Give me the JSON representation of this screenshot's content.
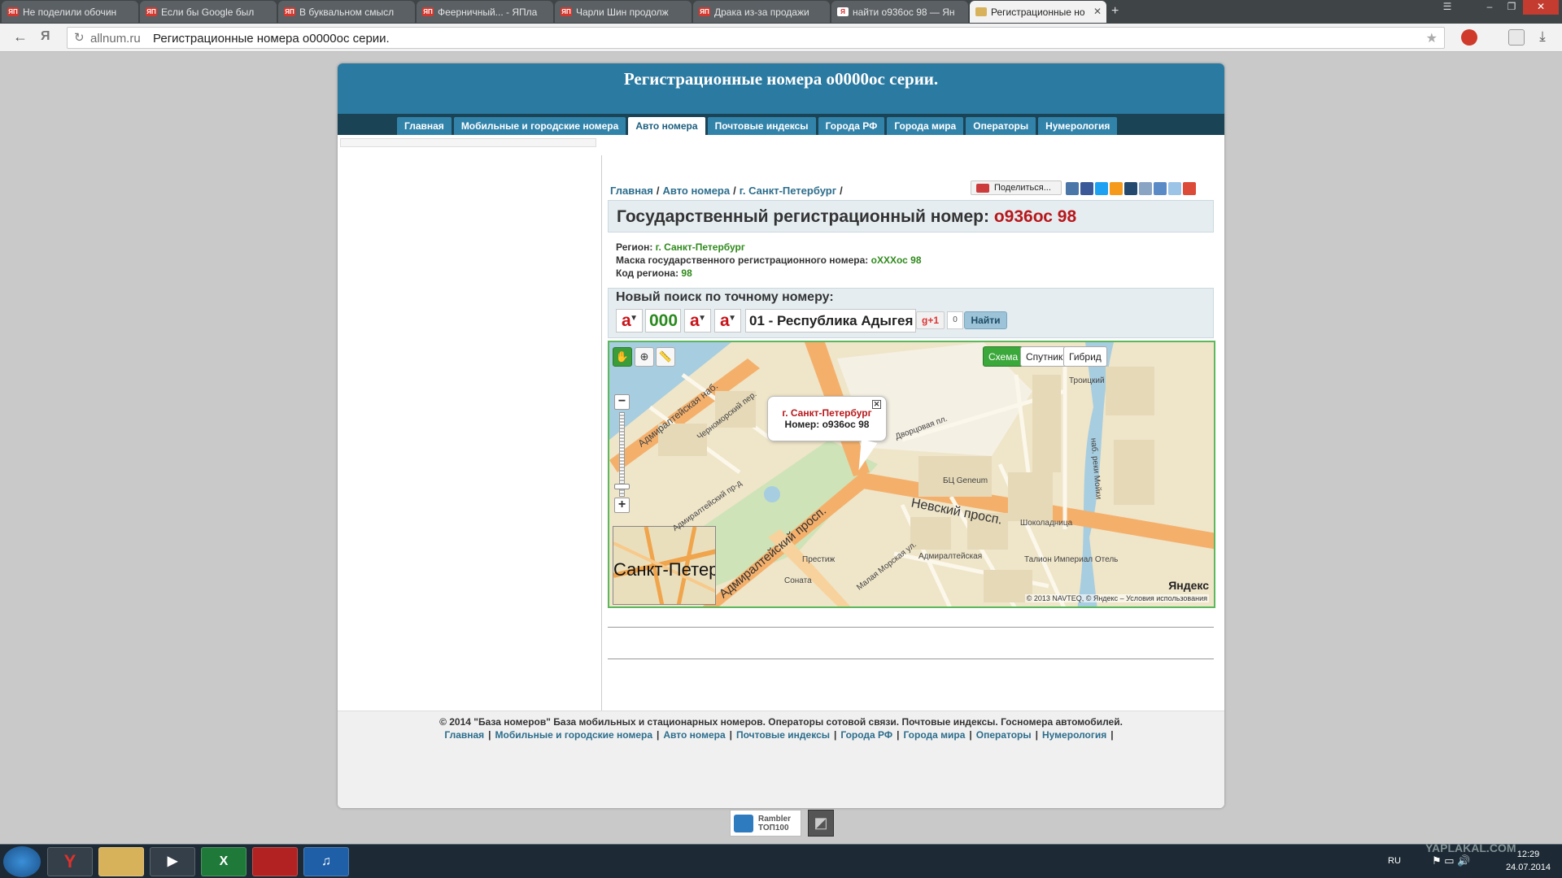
{
  "browser": {
    "tabs": [
      {
        "label": "Не поделили обочин"
      },
      {
        "label": "Если бы Google был"
      },
      {
        "label": "В буквальном смысл"
      },
      {
        "label": "Феерничный... - ЯПла"
      },
      {
        "label": "Чарли Шин продолж"
      },
      {
        "label": "Драка из-за продажи"
      },
      {
        "label": "найти о936ос 98 — Ян"
      },
      {
        "label": "Регистрационные но"
      }
    ],
    "active_tab": 7,
    "url_host": "allnum.ru",
    "url_title": "Регистрационные номера о0000ос серии."
  },
  "site": {
    "title": "Регистрационные номера о0000ос серии.",
    "nav": [
      {
        "label": "Главная"
      },
      {
        "label": "Мобильные и городские номера"
      },
      {
        "label": "Авто номера"
      },
      {
        "label": "Почтовые индексы"
      },
      {
        "label": "Города РФ"
      },
      {
        "label": "Города мира"
      },
      {
        "label": "Операторы"
      },
      {
        "label": "Нумерология"
      }
    ],
    "active_nav": 2,
    "breadcrumb": [
      "Главная",
      "Авто номера",
      "г. Санкт-Петербург"
    ],
    "share_label": "Поделиться...",
    "heading_prefix": "Государственный регистрационный номер:",
    "heading_plate": "о936ос 98",
    "details": {
      "region_label": "Регион:",
      "region_value": "г. Санкт-Петербург",
      "mask_label": "Маска государственного регистрационного номера:",
      "mask_value": "оXXXос 98",
      "code_label": "Код региона:",
      "code_value": "98"
    },
    "search": {
      "heading": "Новый поиск по точному номеру:",
      "letter1": "а",
      "digits": "000",
      "letter2": "а",
      "letter3": "а",
      "region": "01 - Республика Адыгея",
      "gplus": "g+1",
      "gcount": "0",
      "button": "Найти"
    },
    "map": {
      "types": [
        "Схема",
        "Спутник",
        "Гибрид"
      ],
      "active_type": 0,
      "popup_city": "г. Санкт-Петербург",
      "popup_number": "Номер: о936ос 98",
      "minimap_label": "Санкт-Петербу",
      "labels": {
        "nevsky": "Невский просп.",
        "admiralteysky": "Адмиралтейский просп.",
        "admiralteyskaya_nab": "Адмиралтейская наб.",
        "admiralteysky_pr": "Адмиралтейский пр-д",
        "chernomorsky": "Черноморский пер.",
        "dvortsovaya": "Дворцовая пл.",
        "moyka": "наб. реки Мойки",
        "geneum": "БЦ Geneum",
        "metro": "Адмиралтейская",
        "taleon": "Талион Империал Отель",
        "shokoladnitsa": "Шоколадница",
        "prestizh": "Престиж",
        "sonata": "Соната",
        "malaya_morskaya": "Малая Морская ул.",
        "troitsky": "Троицкий"
      },
      "copyright": "© 2013 NAVTEQ, © Яндекс – Условия использования",
      "logo": "Яндекс"
    },
    "footer": {
      "text": "© 2014 \"База номеров\" База мобильных и стационарных номеров. Операторы сотовой связи. Почтовые индексы. Госномера автомобилей.",
      "links": [
        "Главная",
        "Мобильные и городские номера",
        "Авто номера",
        "Почтовые индексы",
        "Города РФ",
        "Города мира",
        "Операторы",
        "Нумерология"
      ]
    },
    "counter_label": "Rambler ТОП100"
  },
  "taskbar": {
    "lang": "RU",
    "time": "12:29",
    "date": "24.07.2014",
    "watermark": "YAPLAKAL.COM"
  },
  "colors": {
    "site_header": "#2b7aa1",
    "site_nav": "#1a4355",
    "plate_red": "#b8171a",
    "value_green": "#2f8a1c",
    "map_green": "#5cb85c"
  }
}
